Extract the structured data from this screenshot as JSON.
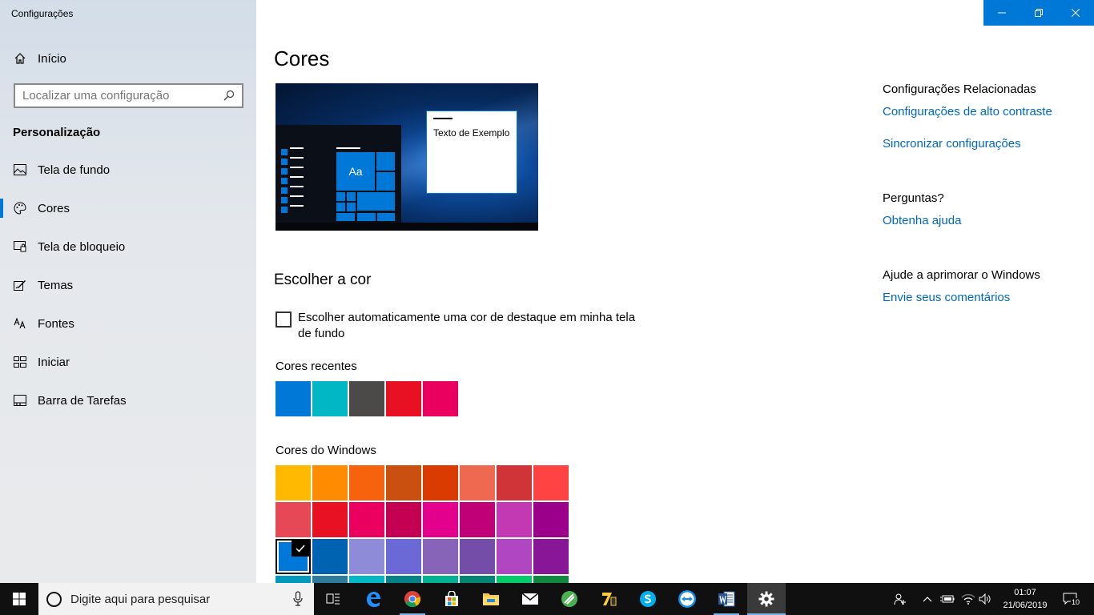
{
  "window": {
    "title": "Configurações",
    "controls": {
      "minimize": "minimize-icon",
      "restore": "restore-icon",
      "close": "close-icon"
    }
  },
  "sidebar": {
    "home_label": "Início",
    "search_placeholder": "Localizar uma configuração",
    "section_title": "Personalização",
    "items": [
      {
        "label": "Tela de fundo",
        "icon": "picture-icon"
      },
      {
        "label": "Cores",
        "icon": "palette-icon",
        "active": true
      },
      {
        "label": "Tela de bloqueio",
        "icon": "lock-screen-icon"
      },
      {
        "label": "Temas",
        "icon": "themes-icon"
      },
      {
        "label": "Fontes",
        "icon": "fonts-icon"
      },
      {
        "label": "Iniciar",
        "icon": "start-icon"
      },
      {
        "label": "Barra de Tarefas",
        "icon": "taskbar-icon"
      }
    ]
  },
  "main": {
    "title": "Cores",
    "preview": {
      "tile_label": "Aa",
      "sample_text": "Texto de Exemplo"
    },
    "choose_heading": "Escolher a cor",
    "auto_color_label": "Escolher automaticamente uma cor de destaque em minha tela de fundo",
    "auto_color_checked": false,
    "recent_label": "Cores recentes",
    "recent_colors": [
      "#0078d7",
      "#00b7c3",
      "#4c4a48",
      "#e81123",
      "#ea005e"
    ],
    "windows_label": "Cores do Windows",
    "windows_colors": [
      [
        "#ffb900",
        "#ff8c00",
        "#f7630c",
        "#ca5010",
        "#da3b01",
        "#ef6950",
        "#d13438",
        "#ff4343"
      ],
      [
        "#e74856",
        "#e81123",
        "#ea005e",
        "#c30052",
        "#e3008c",
        "#bf0077",
        "#c239b3",
        "#9a0089"
      ],
      [
        "#0078d7",
        "#0063b1",
        "#8e8cd8",
        "#6b69d6",
        "#8764b8",
        "#744da9",
        "#b146c2",
        "#881798"
      ],
      [
        "#0099bc",
        "#2d7d9a",
        "#00b7c3",
        "#038387",
        "#00b294",
        "#018574",
        "#00cc6a",
        "#10893e"
      ]
    ],
    "selected_color": "#0078d7"
  },
  "related": {
    "heading": "Configurações Relacionadas",
    "links": [
      "Configurações de alto contraste",
      "Sincronizar configurações"
    ],
    "questions_heading": "Perguntas?",
    "help_link": "Obtenha ajuda",
    "improve_heading": "Ajude a aprimorar o Windows",
    "feedback_link": "Envie seus comentários"
  },
  "taskbar": {
    "search_placeholder": "Digite aqui para pesquisar",
    "apps": [
      "task-view-icon",
      "edge-icon",
      "chrome-icon",
      "store-icon",
      "file-explorer-icon",
      "mail-icon",
      "app-green-icon",
      "7zip-icon",
      "skype-icon",
      "teamviewer-icon",
      "word-icon",
      "settings-icon"
    ],
    "time": "01:07",
    "date": "21/06/2019",
    "notifications_count": "10"
  },
  "colors": {
    "accent": "#0078d7",
    "link": "#0067c0",
    "taskbar": "#101010"
  }
}
